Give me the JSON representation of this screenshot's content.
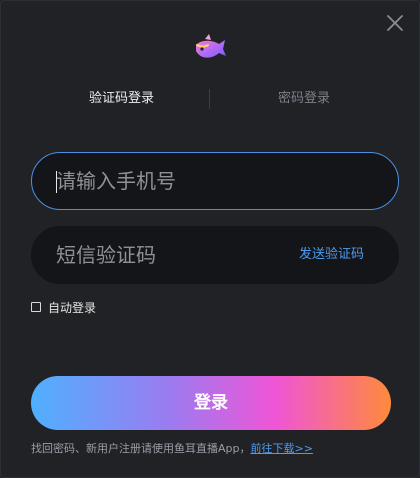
{
  "tabs": {
    "sms_login": "验证码登录",
    "password_login": "密码登录",
    "active": "sms_login"
  },
  "phone": {
    "placeholder": "请输入手机号",
    "value": ""
  },
  "code": {
    "placeholder": "短信验证码",
    "value": "",
    "send_label": "发送验证码"
  },
  "auto_login": {
    "label": "自动登录",
    "checked": false
  },
  "login_button": {
    "label": "登录"
  },
  "footer": {
    "text": "找回密码、新用户注册请使用鱼耳直播App，",
    "link_label": "前往下载>>"
  },
  "icons": {
    "close": "close-icon",
    "logo": "fish-logo-icon"
  },
  "colors": {
    "background": "#202226",
    "accent": "#4d9cf0",
    "input_bg": "#141518",
    "gradient": [
      "#4fb0ff",
      "#9a7cf0",
      "#f055d6",
      "#ff8a3a"
    ]
  }
}
